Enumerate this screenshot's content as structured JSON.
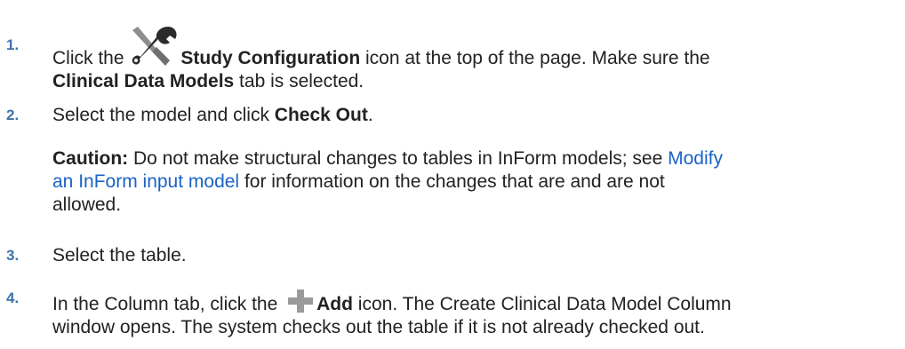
{
  "steps": [
    {
      "number": "1.",
      "pre": "Click the ",
      "icon": "wrench-screwdriver-icon",
      "icon_label": "Study Configuration",
      "post": " icon at the top of the page. Make sure the",
      "line2_bold": "Clinical Data Models",
      "line2_rest": " tab is selected."
    },
    {
      "number": "2.",
      "pre": "Select the model and click ",
      "bold": "Check Out",
      "post": ".",
      "caution": {
        "label": "Caution:",
        "text1": " Do not make structural changes to tables in InForm models; see ",
        "link1": "Modify",
        "link2": "an InForm input model",
        "text2": " for information on the changes that are and are not",
        "text3": "allowed."
      }
    },
    {
      "number": "3.",
      "text": "Select the table."
    },
    {
      "number": "4.",
      "pre": "In the Column tab, click the ",
      "icon": "plus-icon",
      "icon_label": "Add",
      "post": " icon. The Create Clinical Data Model Column",
      "line2": "window opens. The system checks out the table if it is not already checked out."
    }
  ],
  "colors": {
    "number": "#3c72ab",
    "link": "#1a63c6",
    "text": "#222222",
    "icon_dark": "#2b2b2b",
    "icon_grey": "#9a9a9a"
  }
}
